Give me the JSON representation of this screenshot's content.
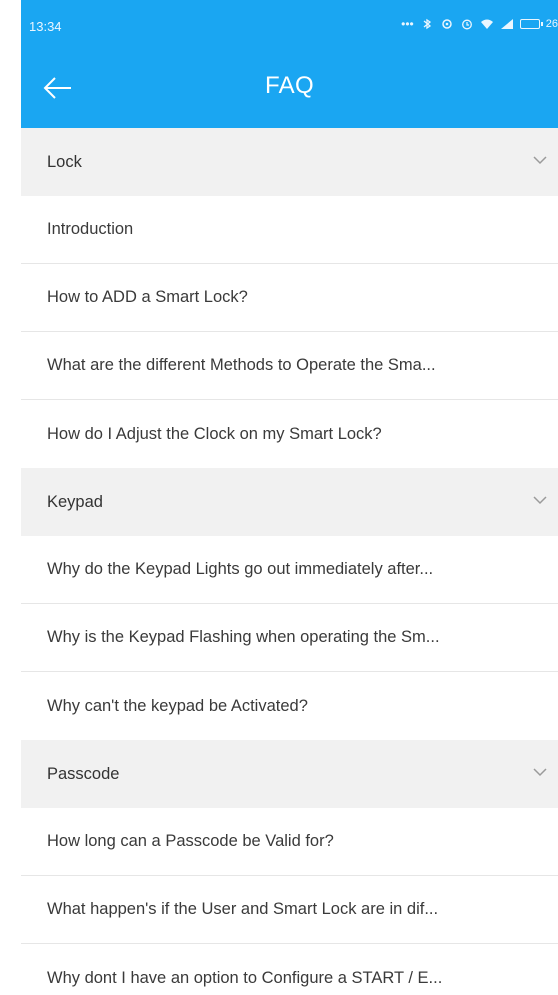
{
  "status_bar": {
    "time": "13:34",
    "battery_text": "26"
  },
  "appbar": {
    "title": "FAQ",
    "color": "#1aa6f2"
  },
  "sections": [
    {
      "label": "Lock",
      "items": [
        "Introduction",
        "How to ADD a Smart Lock?",
        "What are the different Methods to Operate the Sma...",
        "How do I Adjust the Clock on my Smart Lock?"
      ]
    },
    {
      "label": "Keypad",
      "items": [
        "Why do the Keypad Lights go out immediately after...",
        "Why is the Keypad Flashing when operating the Sm...",
        "Why can't the keypad be Activated?"
      ]
    },
    {
      "label": "Passcode",
      "items": [
        "How long can a Passcode be Valid for?",
        "What happen's if the User and Smart Lock are in dif...",
        "Why dont I have an option to Configure a START / E..."
      ]
    }
  ]
}
